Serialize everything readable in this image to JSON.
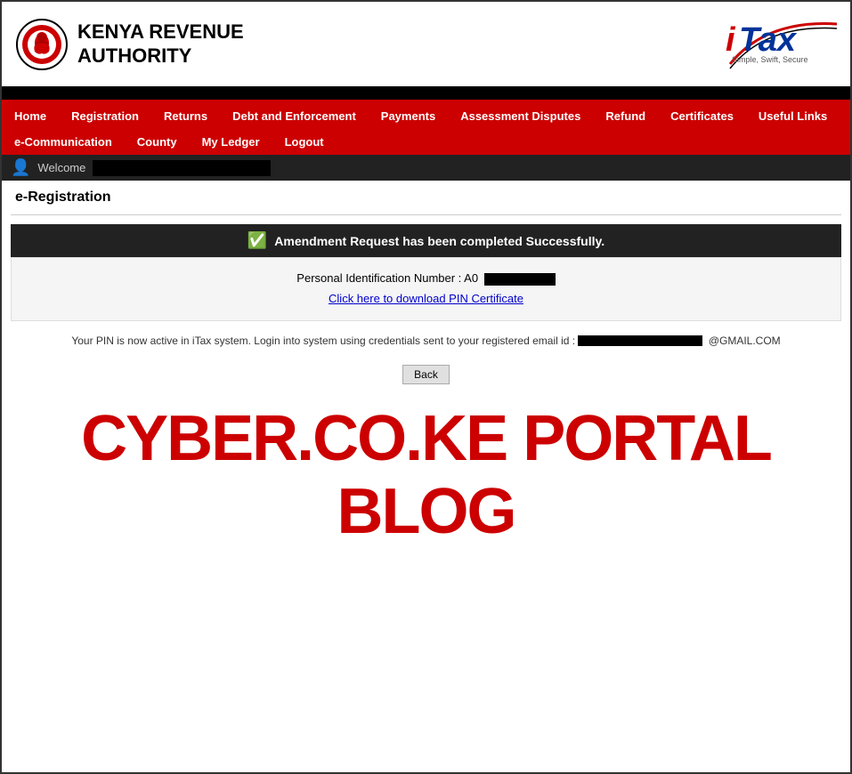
{
  "header": {
    "kra_name_line1": "Kenya Revenue",
    "kra_name_line2": "Authority",
    "itax_brand": "iTax",
    "itax_tagline": "Simple, Swift, Secure"
  },
  "nav": {
    "row1": [
      {
        "label": "Home",
        "id": "home"
      },
      {
        "label": "Registration",
        "id": "registration"
      },
      {
        "label": "Returns",
        "id": "returns"
      },
      {
        "label": "Debt and Enforcement",
        "id": "debt"
      },
      {
        "label": "Payments",
        "id": "payments"
      },
      {
        "label": "Assessment Disputes",
        "id": "assessment"
      },
      {
        "label": "Refund",
        "id": "refund"
      },
      {
        "label": "Certificates",
        "id": "certificates"
      },
      {
        "label": "Useful Links",
        "id": "useful-links"
      }
    ],
    "row2": [
      {
        "label": "e-Communication",
        "id": "ecomm"
      },
      {
        "label": "County",
        "id": "county"
      },
      {
        "label": "My Ledger",
        "id": "ledger"
      },
      {
        "label": "Logout",
        "id": "logout"
      }
    ]
  },
  "welcome": {
    "label": "Welcome",
    "username": ""
  },
  "page": {
    "title": "e-Registration",
    "success_message": "Amendment Request has been completed Successfully.",
    "pin_label": "Personal Identification Number : A0",
    "pin_value": "",
    "download_link_text": "Click here to download PIN Certificate",
    "email_notice": "Your PIN is now active in iTax system. Login into system using credentials sent to your registered email id :",
    "email_redacted": "",
    "email_domain": "@GMAIL.COM",
    "back_button_label": "Back"
  },
  "watermark": {
    "text": "CYBER.CO.KE PORTAL BLOG"
  }
}
